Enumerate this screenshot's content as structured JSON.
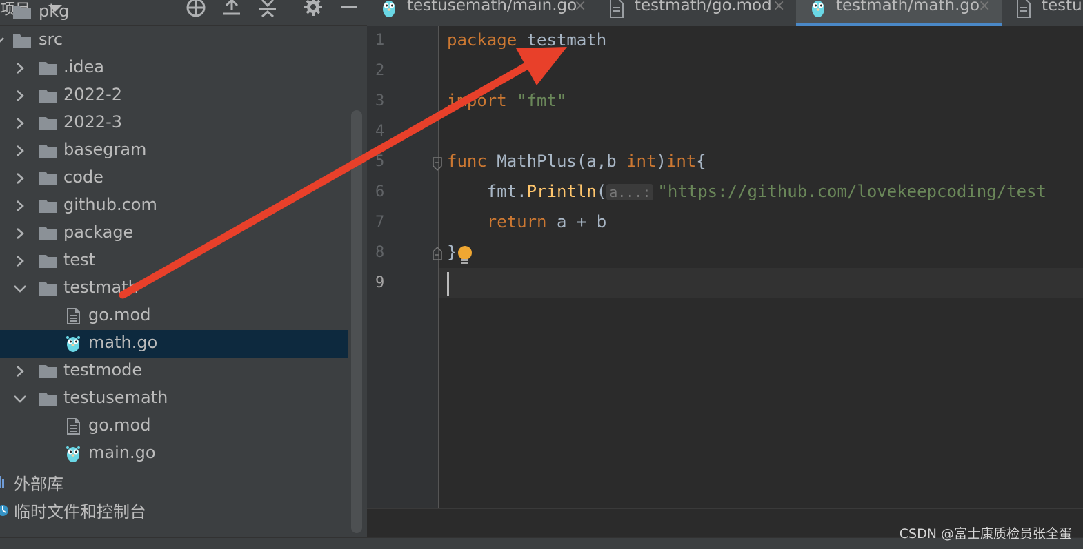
{
  "project_panel": {
    "title": "项目",
    "tree": [
      {
        "label": "pkg",
        "type": "folder",
        "level": 0,
        "expanded": null
      },
      {
        "label": "src",
        "type": "folder",
        "level": 0,
        "expanded": true
      },
      {
        "label": ".idea",
        "type": "folder",
        "level": 1,
        "expanded": false
      },
      {
        "label": "2022-2",
        "type": "folder",
        "level": 1,
        "expanded": false
      },
      {
        "label": "2022-3",
        "type": "folder",
        "level": 1,
        "expanded": false
      },
      {
        "label": "basegram",
        "type": "folder",
        "level": 1,
        "expanded": false
      },
      {
        "label": "code",
        "type": "folder",
        "level": 1,
        "expanded": false
      },
      {
        "label": "github.com",
        "type": "folder",
        "level": 1,
        "expanded": false
      },
      {
        "label": "package",
        "type": "folder",
        "level": 1,
        "expanded": false
      },
      {
        "label": "test",
        "type": "folder",
        "level": 1,
        "expanded": false
      },
      {
        "label": "testmath",
        "type": "folder",
        "level": 1,
        "expanded": true
      },
      {
        "label": "go.mod",
        "type": "file-mod",
        "level": 2,
        "expanded": null
      },
      {
        "label": "math.go",
        "type": "file-go",
        "level": 2,
        "expanded": null,
        "selected": true
      },
      {
        "label": "testmode",
        "type": "folder",
        "level": 1,
        "expanded": false
      },
      {
        "label": "testusemath",
        "type": "folder",
        "level": 1,
        "expanded": true
      },
      {
        "label": "go.mod",
        "type": "file-mod",
        "level": 2,
        "expanded": null
      },
      {
        "label": "main.go",
        "type": "file-go",
        "level": 2,
        "expanded": null
      },
      {
        "label": "外部库",
        "type": "libraries",
        "level": 0,
        "expanded": null
      },
      {
        "label": "临时文件和控制台",
        "type": "scratches",
        "level": 0,
        "expanded": null
      }
    ]
  },
  "tabs": [
    {
      "label": "testusemath/main.go",
      "icon": "gopher-icon",
      "active": false,
      "close": "×"
    },
    {
      "label": "testmath/go.mod",
      "icon": "file-icon",
      "active": false,
      "close": "×"
    },
    {
      "label": "testmath/math.go",
      "icon": "gopher-icon",
      "active": true,
      "close": "×"
    },
    {
      "label": "testus",
      "icon": "file-icon",
      "active": false,
      "close": ""
    }
  ],
  "editor": {
    "line_numbers": [
      "1",
      "2",
      "3",
      "4",
      "5",
      "6",
      "7",
      "8",
      "9"
    ],
    "current_line": "9",
    "code": {
      "l1_kw": "package",
      "l1_name": "testmath",
      "l3_kw": "import",
      "l3_str": "\"fmt\"",
      "l5_kw": "func",
      "l5_name": "MathPlus",
      "l5_params_open": "(a,b ",
      "l5_type1": "int",
      "l5_close": ")",
      "l5_type2": "int",
      "l5_brace": "{",
      "l6_pkg": "fmt.",
      "l6_fn": "Println",
      "l6_paren": "(",
      "l6_hint": "a...:",
      "l6_str": "\"https://github.com/lovekeepcoding/test",
      "l7_kw": "return",
      "l7_expr": " a + b",
      "l8_brace": "}"
    }
  },
  "watermark": "CSDN @富士康质检员张全蛋",
  "colors": {
    "keyword": "#cc7832",
    "string": "#6a8759",
    "arrow": "#e8402a",
    "selection": "#0d293e",
    "tab_underline": "#4a88c7"
  }
}
